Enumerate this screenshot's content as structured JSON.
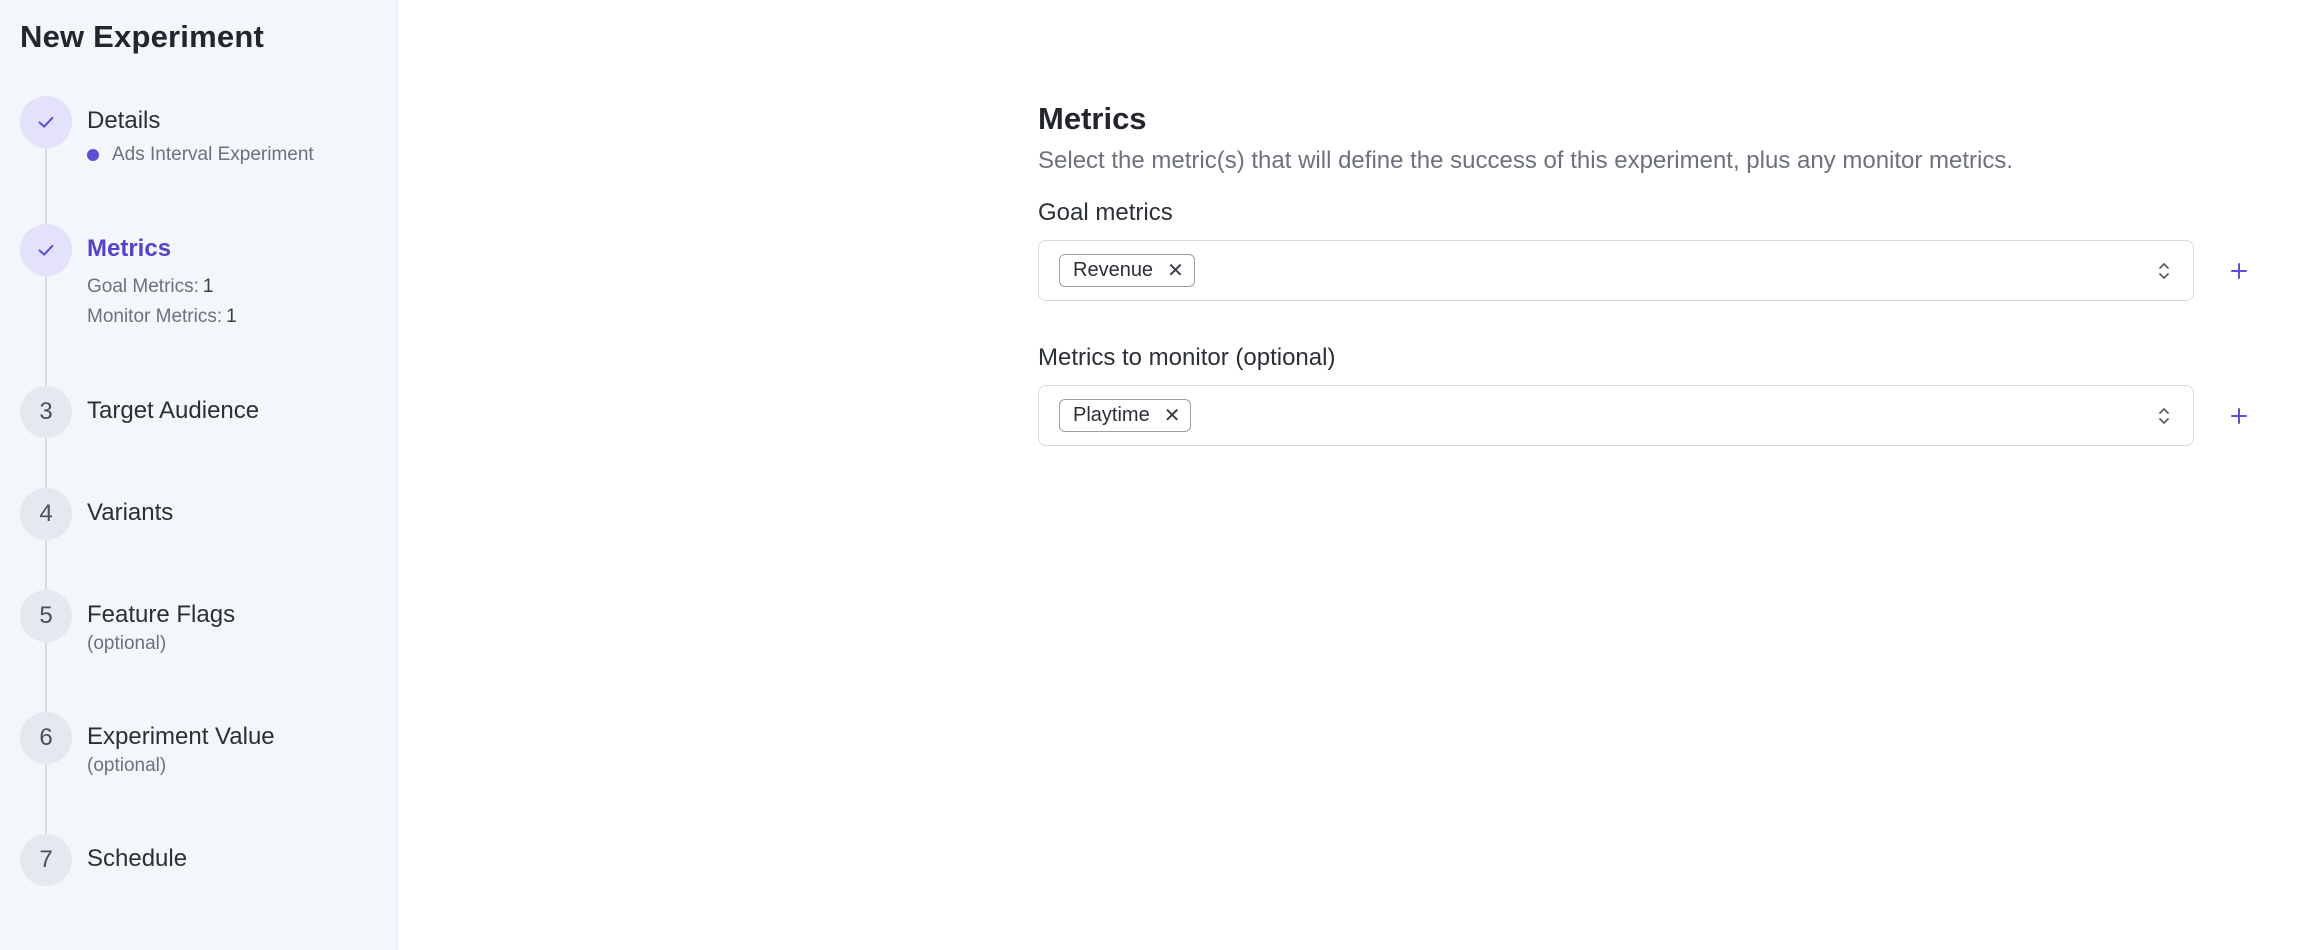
{
  "sidebar": {
    "title": "New Experiment",
    "steps": [
      {
        "number": "",
        "label": "Details",
        "status": "complete",
        "details": [
          "Ads Interval Experiment"
        ]
      },
      {
        "number": "",
        "label": "Metrics",
        "status": "active",
        "summary": [
          {
            "label": "Goal Metrics:",
            "value": "1"
          },
          {
            "label": "Monitor Metrics:",
            "value": "1"
          }
        ]
      },
      {
        "number": "3",
        "label": "Target Audience"
      },
      {
        "number": "4",
        "label": "Variants"
      },
      {
        "number": "5",
        "label": "Feature Flags",
        "optional": "(optional)"
      },
      {
        "number": "6",
        "label": "Experiment Value",
        "optional": "(optional)"
      },
      {
        "number": "7",
        "label": "Schedule"
      }
    ]
  },
  "main": {
    "title": "Metrics",
    "description": "Select the metric(s) that will define the success of this experiment, plus any monitor metrics.",
    "goal_metrics": {
      "label": "Goal metrics",
      "selected": [
        "Revenue"
      ],
      "remove_icon": "close-icon",
      "add_icon": "plus-icon"
    },
    "monitor_metrics": {
      "label": "Metrics to monitor (optional)",
      "selected": [
        "Playtime"
      ],
      "remove_icon": "close-icon",
      "add_icon": "plus-icon"
    }
  },
  "colors": {
    "accent": "#5b4fd6",
    "active_text": "#5144c9",
    "sidebar_bg": "#f3f6fb",
    "completed_bg": "#e4e1fb"
  }
}
